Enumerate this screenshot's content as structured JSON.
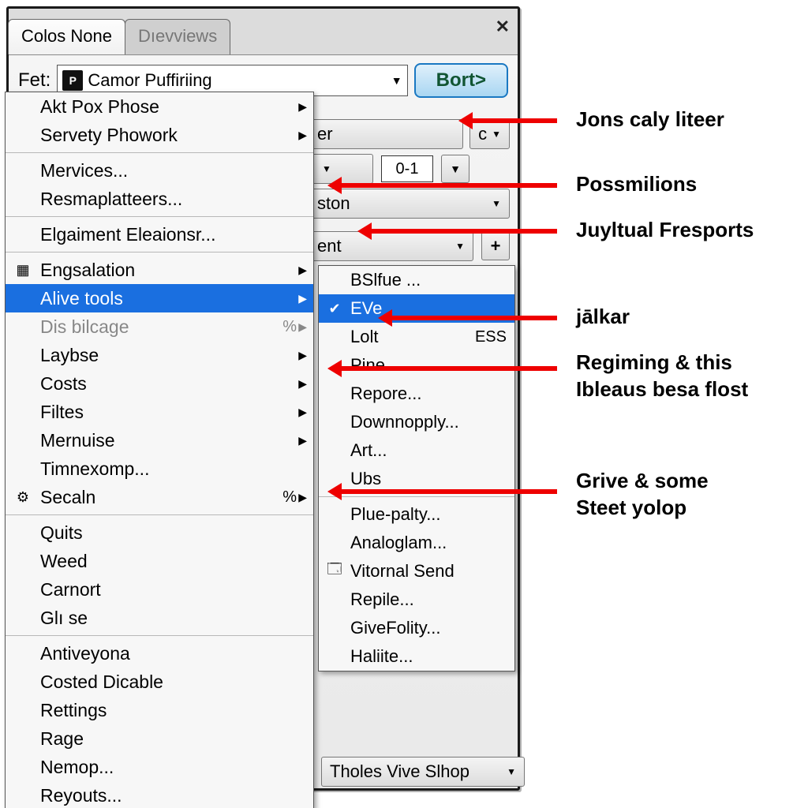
{
  "tabs": {
    "active": "Colos None",
    "inactive": "Dıevviews"
  },
  "close": "✕",
  "fet": {
    "label": "Fet:",
    "value": "Camor Puffiriing",
    "icon": "P"
  },
  "bort": "Bort>",
  "bg": {
    "row1_right": "er",
    "row1_c": "c",
    "mini": "0-1",
    "row2": "ston",
    "row3": "ent",
    "footer": "Tholes Vive Slhop"
  },
  "menu": [
    {
      "t": "Akt Pox Phose",
      "sub": true
    },
    {
      "t": "Servety Phowork",
      "sub": true
    },
    {
      "sep": true
    },
    {
      "t": "Mervices..."
    },
    {
      "t": "Resmaplatteers..."
    },
    {
      "sep": true
    },
    {
      "t": "Elgaiment Eleaionsr..."
    },
    {
      "sep": true
    },
    {
      "t": "Engsalation",
      "sub": true,
      "ico": "▦"
    },
    {
      "t": "Alive tools",
      "sub": true,
      "hl": true
    },
    {
      "t": "Dis bilcage",
      "sub": true,
      "dim": true,
      "sc": "%"
    },
    {
      "t": "Laybse",
      "sub": true
    },
    {
      "t": "Costs",
      "sub": true
    },
    {
      "t": "Filtes",
      "sub": true
    },
    {
      "t": "Mernuise",
      "sub": true
    },
    {
      "t": "Timnexomp..."
    },
    {
      "t": "Secaln",
      "sub": true,
      "ico": "⚙",
      "sc": "%"
    },
    {
      "sep": true
    },
    {
      "t": "Quits"
    },
    {
      "t": "Weed"
    },
    {
      "t": "Carnort"
    },
    {
      "t": "Glı se"
    },
    {
      "sep": true
    },
    {
      "t": "Antiveyona"
    },
    {
      "t": "Costed Dicable"
    },
    {
      "t": "Rettings"
    },
    {
      "t": "Rage"
    },
    {
      "t": "Nemop..."
    },
    {
      "t": "Reyouts..."
    }
  ],
  "submenu": [
    {
      "t": "BSlfue ..."
    },
    {
      "t": "EVe",
      "hl": true,
      "ico": "✔"
    },
    {
      "t": "Lolt",
      "sc": "ESS"
    },
    {
      "t": "Pine..."
    },
    {
      "t": "Repore..."
    },
    {
      "t": "Downnopply..."
    },
    {
      "t": "Art..."
    },
    {
      "t": "Ubs"
    },
    {
      "sep": true
    },
    {
      "t": "Plue-palty..."
    },
    {
      "t": "Analoglam..."
    },
    {
      "t": "Vitornal Send",
      "ico": "🗔"
    },
    {
      "t": "Repile..."
    },
    {
      "t": "GiveFolity..."
    },
    {
      "t": "Haliite..."
    }
  ],
  "callouts": {
    "c1": "Jons caly liteer",
    "c2": "Possmilions",
    "c3": "Juyltual Fresports",
    "c4": "jālkar",
    "c5a": "Regiming & this",
    "c5b": "Ibleaus besa flost",
    "c6a": "Grive & some",
    "c6b": "Steet yolop"
  }
}
